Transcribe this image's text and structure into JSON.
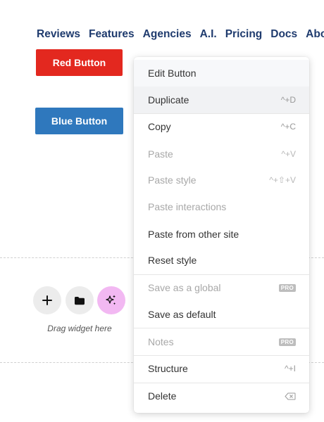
{
  "nav": {
    "items": [
      "Reviews",
      "Features",
      "Agencies",
      "A.I.",
      "Pricing",
      "Docs",
      "About"
    ]
  },
  "canvas": {
    "red_button": "Red Button",
    "blue_button": "Blue Button",
    "drag_text": "Drag widget here",
    "colors": {
      "red": "#e3281f",
      "blue": "#2f78bd",
      "ai": "#f2b8f2"
    }
  },
  "menu": {
    "edit": "Edit Button",
    "duplicate": {
      "label": "Duplicate",
      "shortcut": "^+D"
    },
    "copy": {
      "label": "Copy",
      "shortcut": "^+C"
    },
    "paste": {
      "label": "Paste",
      "shortcut": "^+V"
    },
    "paste_style": {
      "label": "Paste style",
      "shortcut": "^+⇧+V"
    },
    "paste_interactions": {
      "label": "Paste interactions"
    },
    "paste_other": {
      "label": "Paste from other site"
    },
    "reset_style": {
      "label": "Reset style"
    },
    "save_global": {
      "label": "Save as a global",
      "badge": "PRO"
    },
    "save_default": {
      "label": "Save as default"
    },
    "notes": {
      "label": "Notes",
      "badge": "PRO"
    },
    "structure": {
      "label": "Structure",
      "shortcut": "^+I"
    },
    "delete": {
      "label": "Delete",
      "icon": "backspace-icon"
    }
  }
}
